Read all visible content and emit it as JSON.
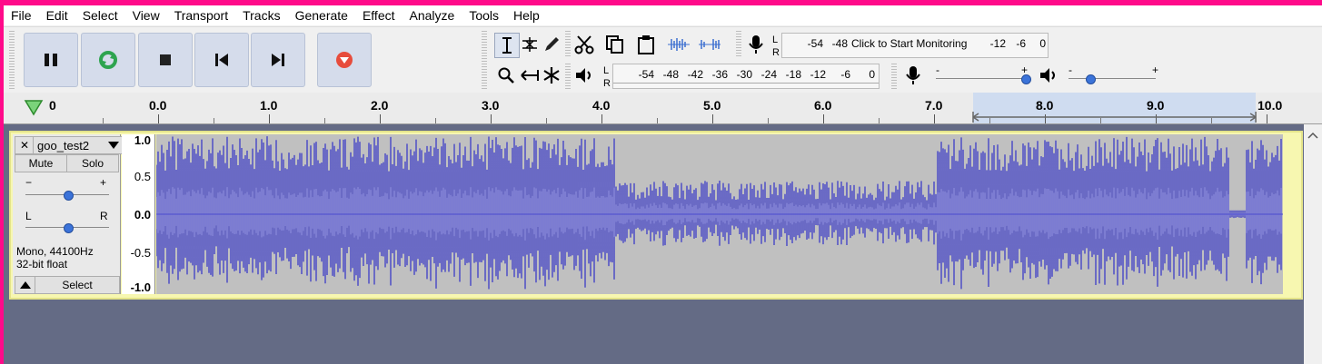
{
  "menu": [
    "File",
    "Edit",
    "Select",
    "View",
    "Transport",
    "Tracks",
    "Generate",
    "Effect",
    "Analyze",
    "Tools",
    "Help"
  ],
  "transport": {
    "pause": "pause-icon",
    "loop": "loop-icon",
    "stop": "stop-icon",
    "skip_start": "skip-to-start-icon",
    "skip_end": "skip-to-end-icon",
    "record": "record-icon"
  },
  "recording_meter": {
    "ticks": [
      "-54",
      "-48"
    ],
    "prompt": "Click to Start Monitoring",
    "ticks_right": [
      "-12",
      "-6",
      "0"
    ]
  },
  "playback_meter": {
    "ticks": [
      "-54",
      "-48",
      "-42",
      "-36",
      "-30",
      "-24",
      "-18",
      "-12",
      "-6",
      "0"
    ]
  },
  "meter_channel_labels": {
    "left": "L",
    "right": "R"
  },
  "mixer": {
    "record_minus": "-",
    "record_plus": "+",
    "play_minus": "-",
    "play_plus": "+",
    "record_level": 1.0,
    "play_level": 0.22
  },
  "timeline": {
    "labels": [
      "0",
      "0.0",
      "1.0",
      "2.0",
      "3.0",
      "4.0",
      "5.0",
      "6.0",
      "7.0",
      "8.0",
      "9.0",
      "10.0"
    ],
    "selection": [
      7.35,
      9.9
    ]
  },
  "track": {
    "name": "goo_test2",
    "mute": "Mute",
    "solo": "Solo",
    "gain_minus": "−",
    "gain_plus": "+",
    "pan_left": "L",
    "pan_right": "R",
    "format": "Mono, 44100Hz",
    "bitdepth": "32-bit float",
    "select": "Select",
    "close": "✕",
    "scale": [
      "1.0",
      "0.5",
      "0.0",
      "-0.5",
      "-1.0"
    ]
  },
  "colors": {
    "waveform": "#3232c8",
    "waveform_rms": "#6464dc",
    "accent": "#ff0a8a"
  }
}
